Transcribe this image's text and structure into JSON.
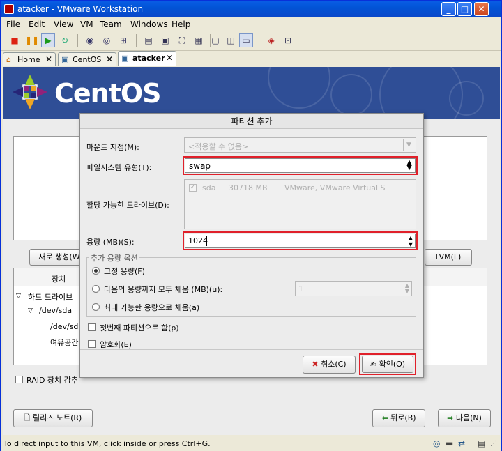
{
  "window": {
    "title": "atacker - VMware Workstation"
  },
  "menu": [
    "File",
    "Edit",
    "View",
    "VM",
    "Team",
    "Windows",
    "Help"
  ],
  "tabs": [
    {
      "label": "Home"
    },
    {
      "label": "CentOS"
    },
    {
      "label": "atacker"
    }
  ],
  "brand": {
    "name": "CentOS"
  },
  "installer": {
    "new_button": "새로 생성(W",
    "lvm_button": "LVM(L)",
    "device_header": "장치",
    "tree": [
      "하드 드라이브",
      "/dev/sda",
      "/dev/sda",
      "여유공간"
    ],
    "raid_label": "RAID 장치 감추",
    "release_notes": "릴리즈 노트(R)",
    "back": "뒤로(B)",
    "next": "다음(N)"
  },
  "dialog": {
    "title": "파티션 추가",
    "mount_label": "마운트 지점(M):",
    "mount_value": "<적용할 수 없음>",
    "fs_label": "파일시스템 유형(T):",
    "fs_value": "swap",
    "drives_label": "할당 가능한 드라이브(D):",
    "drive": {
      "name": "sda",
      "size": "30718 MB",
      "model": "VMware, VMware Virtual S"
    },
    "size_label": "용량 (MB)(S):",
    "size_value": "1024",
    "options_title": "추가 용량 옵션",
    "opt_fixed": "고정 용량(F)",
    "opt_fill_upto": "다음의 용량까지 모두 채움 (MB)(u):",
    "opt_fill_value": "1",
    "opt_fill_max": "최대 가능한 용량으로 채움(a)",
    "primary_label": "첫번째 파티션으로 함(p)",
    "encrypt_label": "암호화(E)",
    "cancel": "취소(C)",
    "ok": "확인(O)"
  },
  "status": {
    "text": "To direct input to this VM, click inside or press Ctrl+G."
  }
}
